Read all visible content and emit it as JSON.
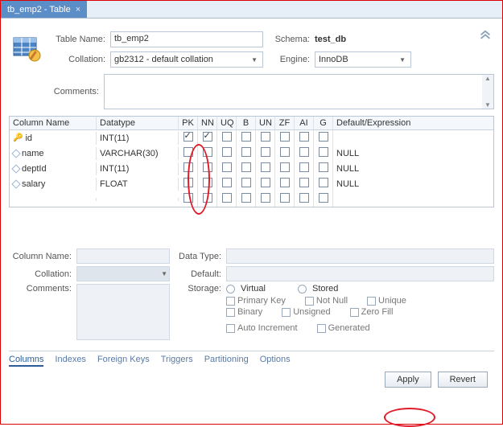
{
  "tab": {
    "title": "tb_emp2 - Table",
    "close": "×"
  },
  "header": {
    "table_name_lbl": "Table Name:",
    "table_name": "tb_emp2",
    "schema_lbl": "Schema:",
    "schema": "test_db",
    "collation_lbl": "Collation:",
    "collation": "gb2312 - default collation",
    "engine_lbl": "Engine:",
    "engine": "InnoDB",
    "comments_lbl": "Comments:",
    "comments": ""
  },
  "cols_header": {
    "name": "Column Name",
    "datatype": "Datatype",
    "pk": "PK",
    "nn": "NN",
    "uq": "UQ",
    "b": "B",
    "un": "UN",
    "zf": "ZF",
    "ai": "AI",
    "g": "G",
    "def": "Default/Expression"
  },
  "columns": [
    {
      "name": "id",
      "datatype": "INT(11)",
      "pk": true,
      "nn": true,
      "uq": false,
      "b": false,
      "un": false,
      "zf": false,
      "ai": false,
      "g": false,
      "def": "",
      "icon": "key"
    },
    {
      "name": "name",
      "datatype": "VARCHAR(30)",
      "pk": false,
      "nn": false,
      "uq": false,
      "b": false,
      "un": false,
      "zf": false,
      "ai": false,
      "g": false,
      "def": "NULL",
      "icon": "diamond"
    },
    {
      "name": "deptId",
      "datatype": "INT(11)",
      "pk": false,
      "nn": false,
      "uq": false,
      "b": false,
      "un": false,
      "zf": false,
      "ai": false,
      "g": false,
      "def": "NULL",
      "icon": "diamond"
    },
    {
      "name": "salary",
      "datatype": "FLOAT",
      "pk": false,
      "nn": false,
      "uq": false,
      "b": false,
      "un": false,
      "zf": false,
      "ai": false,
      "g": false,
      "def": "NULL",
      "icon": "diamond"
    },
    {
      "name": "",
      "datatype": "",
      "pk": false,
      "nn": false,
      "uq": false,
      "b": false,
      "un": false,
      "zf": false,
      "ai": false,
      "g": false,
      "def": "",
      "icon": ""
    }
  ],
  "editor": {
    "col_name_lbl": "Column Name:",
    "collation_lbl": "Collation:",
    "comments_lbl": "Comments:",
    "data_type_lbl": "Data Type:",
    "default_lbl": "Default:",
    "storage_lbl": "Storage:",
    "virtual": "Virtual",
    "stored": "Stored",
    "primary_key": "Primary Key",
    "not_null": "Not Null",
    "unique": "Unique",
    "binary": "Binary",
    "unsigned": "Unsigned",
    "zero_fill": "Zero Fill",
    "auto_increment": "Auto Increment",
    "generated": "Generated"
  },
  "bottom_tabs": {
    "columns": "Columns",
    "indexes": "Indexes",
    "foreign_keys": "Foreign Keys",
    "triggers": "Triggers",
    "partitioning": "Partitioning",
    "options": "Options"
  },
  "buttons": {
    "apply": "Apply",
    "revert": "Revert"
  }
}
